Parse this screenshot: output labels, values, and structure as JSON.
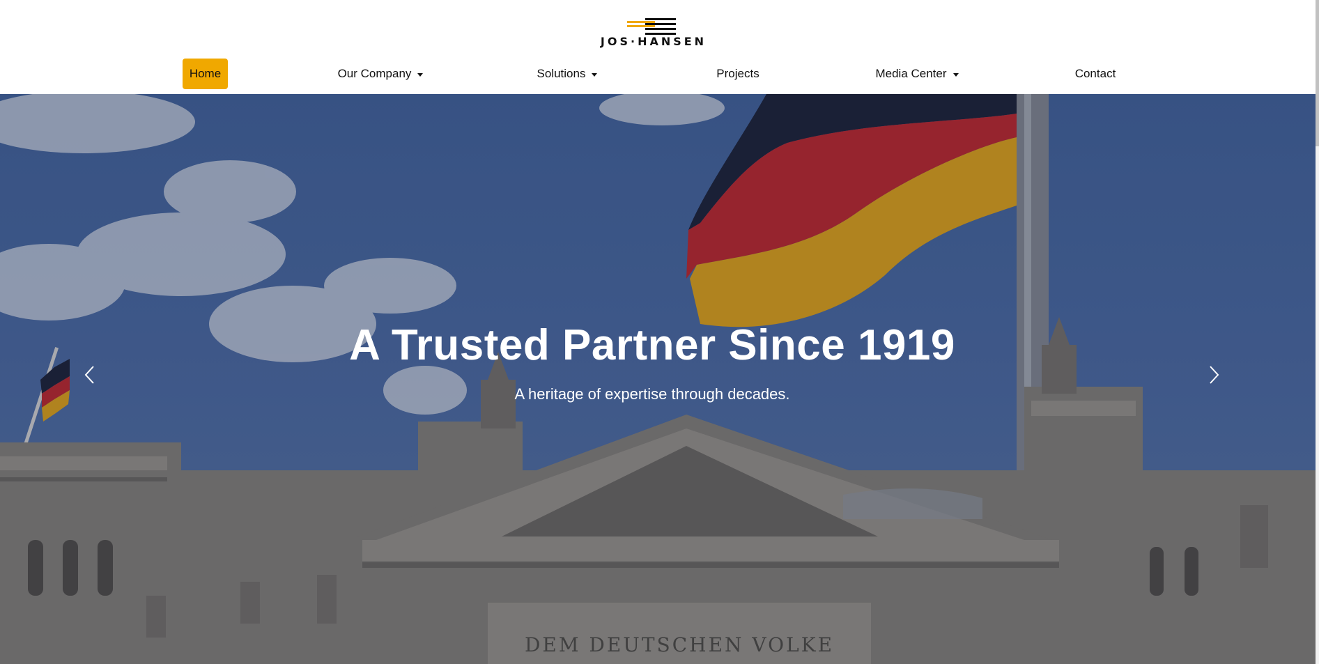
{
  "brand": {
    "name": "JOS·HANSEN",
    "accent_color": "#f0a800",
    "logo_icon": "stripes-logo-icon"
  },
  "nav": {
    "items": [
      {
        "label": "Home",
        "active": true,
        "dropdown": false
      },
      {
        "label": "Our Company",
        "active": false,
        "dropdown": true
      },
      {
        "label": "Solutions",
        "active": false,
        "dropdown": true
      },
      {
        "label": "Projects",
        "active": false,
        "dropdown": false
      },
      {
        "label": "Media Center",
        "active": false,
        "dropdown": true
      },
      {
        "label": "Contact",
        "active": false,
        "dropdown": false
      }
    ]
  },
  "hero": {
    "title": "A Trusted Partner Since 1919",
    "subtitle": "A heritage of expertise through decades.",
    "building_inscription": "DEM DEUTSCHEN VOLKE",
    "prev_icon": "chevron-left-icon",
    "next_icon": "chevron-right-icon"
  }
}
